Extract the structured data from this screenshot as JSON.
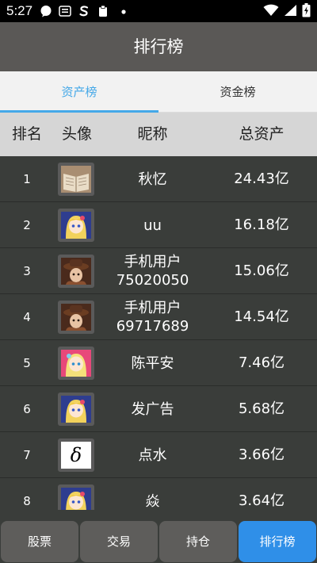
{
  "status_bar": {
    "time": "5:27",
    "icons": [
      "chat-bubble-icon",
      "app-badge-icon",
      "s-logo-icon",
      "clipboard-icon",
      "dot-icon",
      "wifi-icon",
      "signal-icon",
      "battery-charging-icon"
    ]
  },
  "header": {
    "title": "排行榜"
  },
  "tabs": [
    {
      "label": "资产榜",
      "active": true
    },
    {
      "label": "资金榜",
      "active": false
    }
  ],
  "table": {
    "columns": [
      "排名",
      "头像",
      "昵称",
      "总资产"
    ],
    "rows": [
      {
        "rank": "1",
        "avatar": "book-photo-avatar",
        "name": "秋忆",
        "assets": "24.43亿"
      },
      {
        "rank": "2",
        "avatar": "anime-girl-avatar",
        "name": "uu",
        "assets": "16.18亿"
      },
      {
        "rank": "3",
        "avatar": "hat-character-avatar",
        "name_line1": "手机用户",
        "name_line2": "75020050",
        "assets": "15.06亿"
      },
      {
        "rank": "4",
        "avatar": "hat-character-avatar",
        "name_line1": "手机用户",
        "name_line2": "69717689",
        "assets": "14.54亿"
      },
      {
        "rank": "5",
        "avatar": "anime-girl-pink-avatar",
        "name": "陈平安",
        "assets": "7.46亿"
      },
      {
        "rank": "6",
        "avatar": "anime-girl-avatar",
        "name": "发广告",
        "assets": "5.68亿"
      },
      {
        "rank": "7",
        "avatar": "delta-symbol-avatar",
        "avatar_glyph": "δ",
        "name": "点水",
        "assets": "3.66亿"
      },
      {
        "rank": "8",
        "avatar": "anime-girl-avatar",
        "name": "焱",
        "assets": "3.64亿"
      }
    ]
  },
  "bottom_nav": [
    {
      "label": "股票",
      "active": false
    },
    {
      "label": "交易",
      "active": false
    },
    {
      "label": "持仓",
      "active": false
    },
    {
      "label": "排行榜",
      "active": true
    }
  ],
  "colors": {
    "accent": "#44a8e8",
    "nav_active": "#2f8fe8",
    "appbar": "#5a5856",
    "list_bg": "#3a3d3a"
  }
}
